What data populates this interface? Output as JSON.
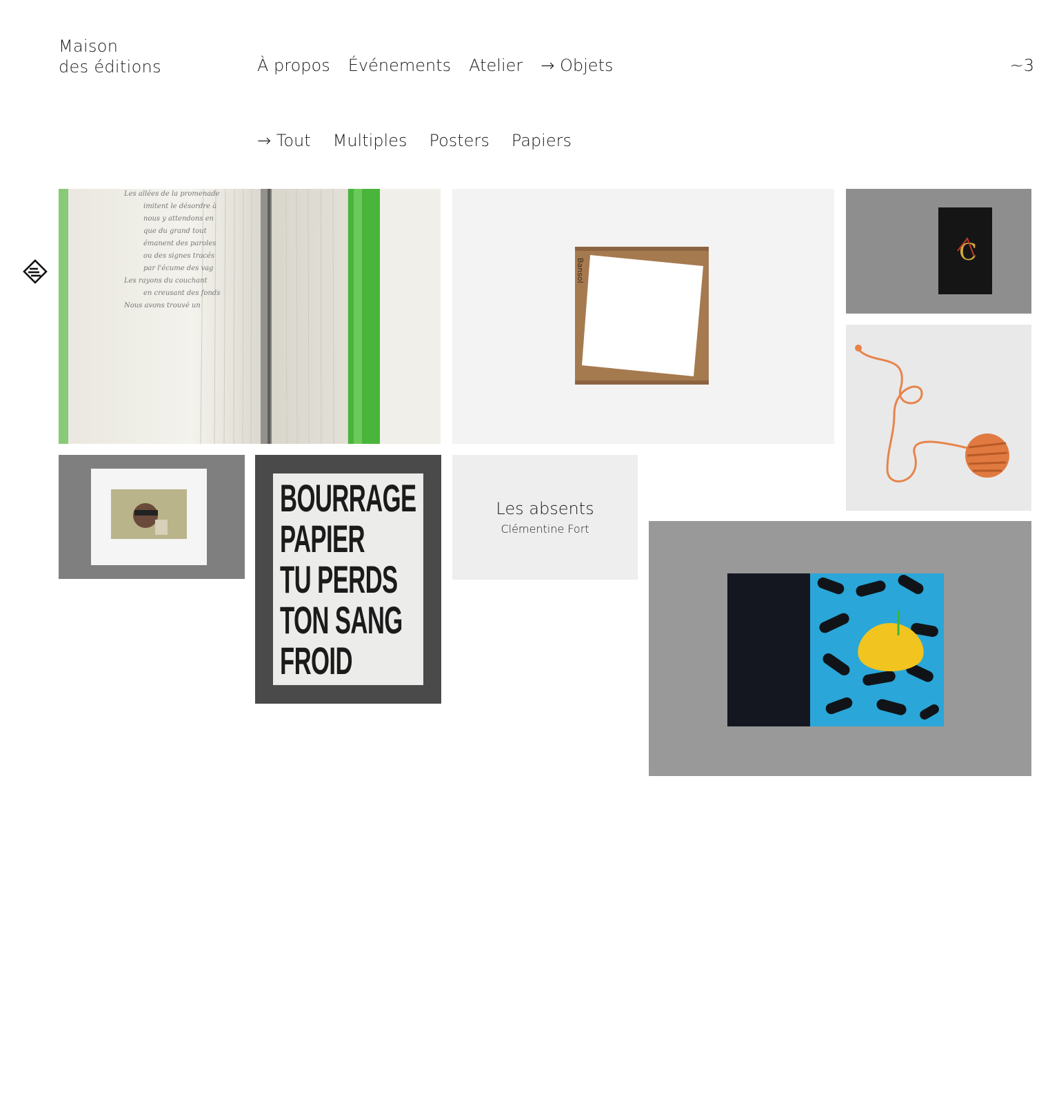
{
  "brand": {
    "line1": "Maison",
    "line2": "des éditions"
  },
  "nav": {
    "items": [
      {
        "label": "À propos"
      },
      {
        "label": "Événements"
      },
      {
        "label": "Atelier"
      },
      {
        "label": "→ Objets"
      }
    ]
  },
  "cart": {
    "label": "~3"
  },
  "subnav": {
    "items": [
      {
        "label": "→ Tout"
      },
      {
        "label": "Multiples"
      },
      {
        "label": "Posters"
      },
      {
        "label": "Papiers"
      }
    ]
  },
  "grid": {
    "poster": {
      "lines": [
        "BOURRAGE",
        "PAPIER",
        "TU PERDS",
        "TON SANG",
        "FROID"
      ]
    },
    "card": {
      "title": "Les absents",
      "author": "Clémentine Fort"
    }
  },
  "colors": {
    "text": "#1a1a1a",
    "card_bg": "#eeeeee",
    "accent_orange": "#e8834a",
    "accent_blue": "#2aa6d9",
    "accent_yellow": "#f2c41f",
    "accent_green": "#3db53a"
  }
}
